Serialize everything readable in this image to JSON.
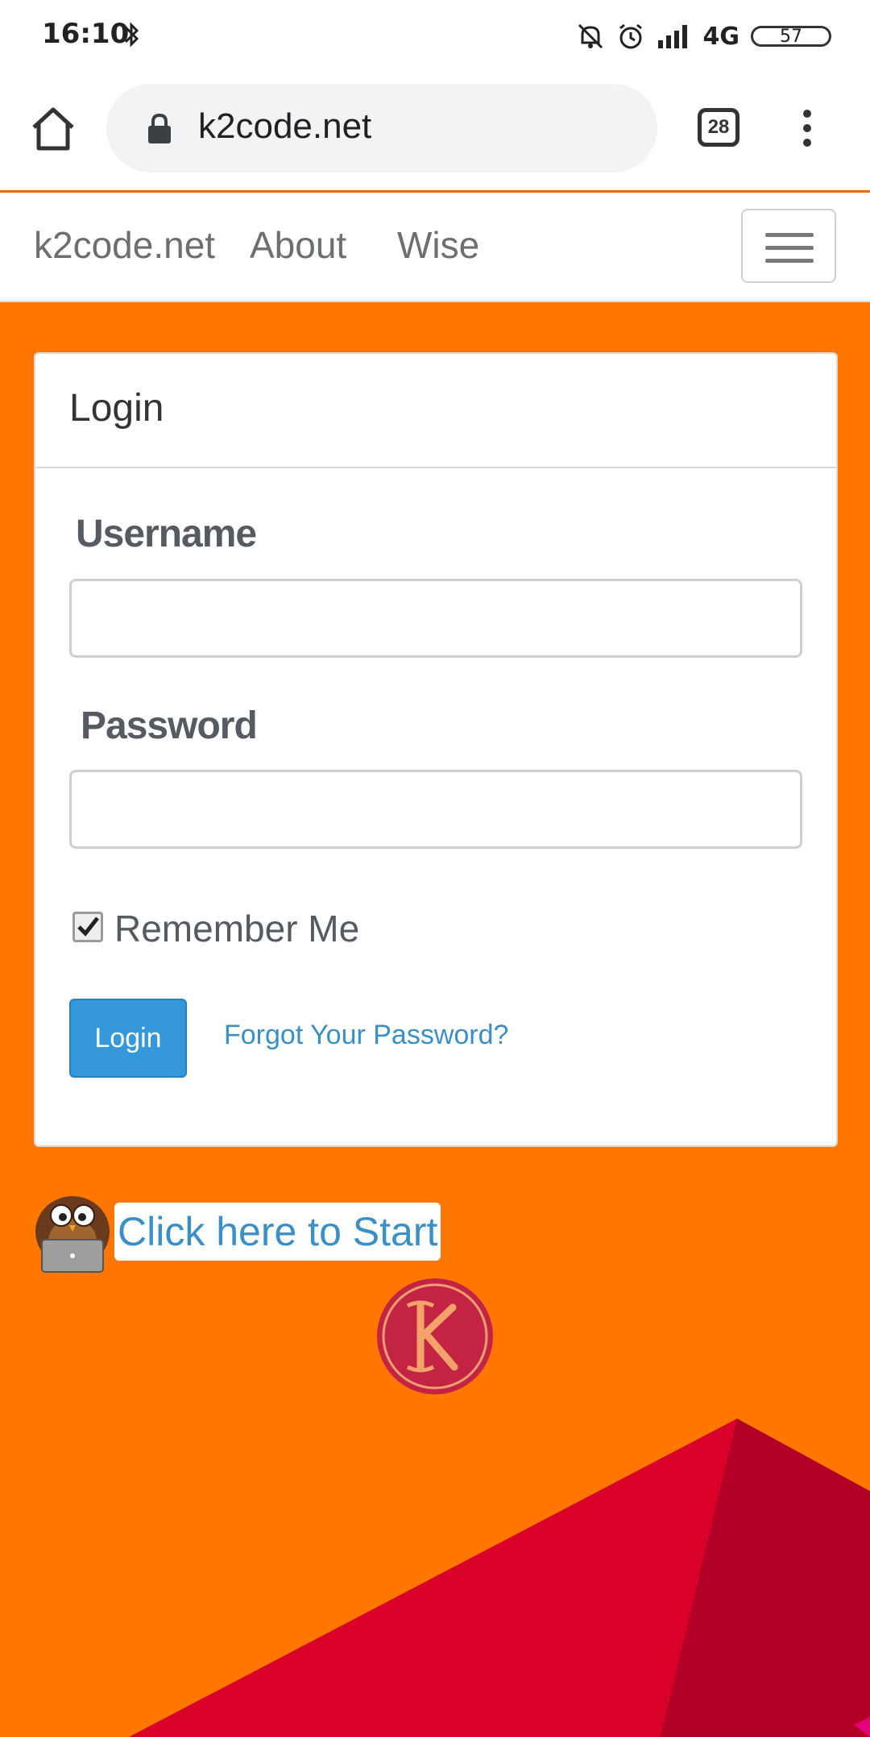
{
  "status_bar": {
    "time": "16:10",
    "network": "4G",
    "battery": "57",
    "icons": [
      "bluetooth-icon",
      "mute-bell-icon",
      "alarm-icon",
      "signal-icon"
    ]
  },
  "browser": {
    "url": "k2code.net",
    "tab_count": "28",
    "icons": [
      "home-icon",
      "lock-icon",
      "overflow-menu-icon"
    ]
  },
  "nav": {
    "brand": "k2code.net",
    "links": [
      "About",
      "Wise"
    ],
    "toggle_icon": "hamburger-icon"
  },
  "login_card": {
    "title": "Login",
    "username_label": "Username",
    "username_value": "",
    "password_label": "Password",
    "password_value": "",
    "remember_label": "Remember Me",
    "remember_checked": true,
    "login_button": "Login",
    "forgot_link": "Forgot Your Password?"
  },
  "promo": {
    "start_link": "Click here to Start",
    "owl_icon": "owl-laptop-icon",
    "logo_icon": "k-logo-icon"
  },
  "colors": {
    "page_bg": "#ff7700",
    "accent_blue": "#3498db",
    "link_blue": "#3a8fc7",
    "shape_red": "#d9002a",
    "shape_dark_red": "#b30026"
  }
}
